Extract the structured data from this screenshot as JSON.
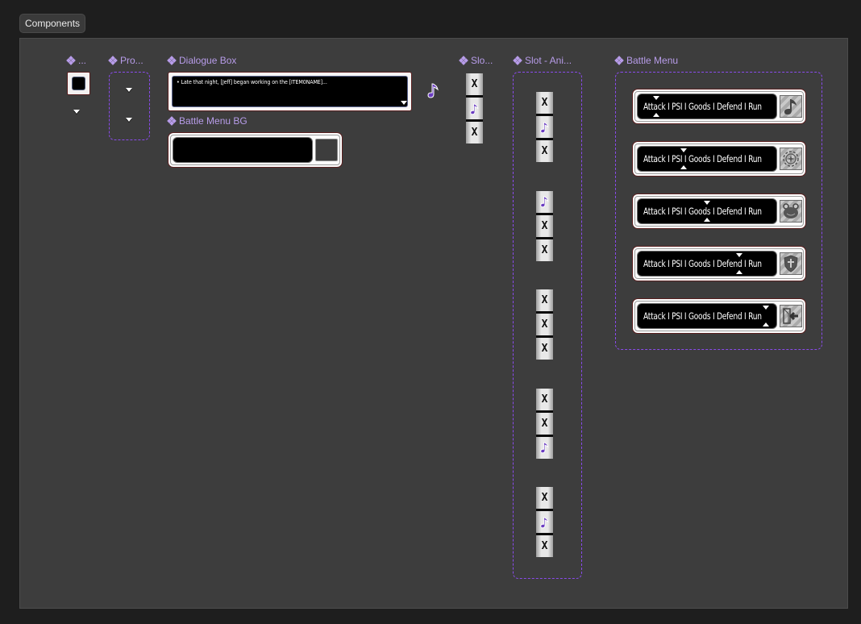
{
  "header": {
    "tab_label": "Components"
  },
  "components": {
    "cursor": {
      "label": "..."
    },
    "prompt": {
      "label": "Pro..."
    },
    "dialogue_box": {
      "label": "Dialogue Box",
      "text": "• Late that night, [Jeff] began working on the [ITEM0NAME]..."
    },
    "battle_menu_bg": {
      "label": "Battle Menu BG"
    },
    "slot": {
      "label": "Slo...",
      "tiles": [
        "x",
        "note",
        "x"
      ]
    },
    "slot_animation": {
      "label": "Slot - Ani...",
      "groups": [
        [
          "x",
          "note",
          "x"
        ],
        [
          "note",
          "x",
          "x"
        ],
        [
          "x",
          "x",
          "x"
        ],
        [
          "x",
          "x",
          "note"
        ],
        [
          "x",
          "note",
          "x"
        ]
      ]
    },
    "battle_menu": {
      "label": "Battle Menu",
      "options_text": "Attack I PSI I Goods I Defend I Run",
      "variants": [
        {
          "selected": "Attack",
          "icon": "music-note-icon"
        },
        {
          "selected": "PSI",
          "icon": "psi-target-icon"
        },
        {
          "selected": "Goods",
          "icon": "frog-bag-icon"
        },
        {
          "selected": "Defend",
          "icon": "shield-icon"
        },
        {
          "selected": "Run",
          "icon": "run-exit-icon"
        }
      ]
    }
  },
  "colors": {
    "accent_purple": "#8a4bec",
    "label_purple": "#b79ce9",
    "note_purple": "#6a3cc0"
  }
}
